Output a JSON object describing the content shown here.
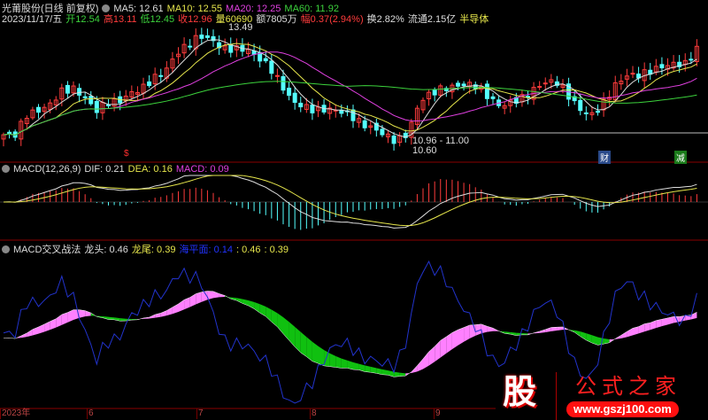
{
  "header": {
    "stock": "光莆股份(日线 前复权)",
    "ma5": "MA5: 12.61",
    "ma10": "MA10: 12.55",
    "ma20": "MA20: 12.25",
    "ma60": "MA60: 11.92",
    "date": "2023/11/17/五",
    "open": "开12.54",
    "high": "高13.11",
    "low": "低12.45",
    "close": "收12.96",
    "volume": "量60690",
    "amount": "额7805万",
    "change": "幅0.37(2.94%)",
    "turnover": "换2.82%",
    "float": "流通2.15亿",
    "sector": "半导体"
  },
  "annotations": {
    "high": "13.49",
    "range": "10.96 - 11.00",
    "low": "10.60",
    "dollar": "$",
    "cai": "财",
    "jian": "减"
  },
  "macd": {
    "title": "MACD(12,26,9)",
    "dif": "DIF: 0.21",
    "dea": "DEA: 0.16",
    "macd": "MACD: 0.09"
  },
  "cross": {
    "title": "MACD交叉战法",
    "head": "龙头: 0.46",
    "tail": "龙尾: 0.39",
    "sea": "海平面: 0.14",
    "v1": ": 0.46",
    "v2": ": 0.39"
  },
  "axis": {
    "labels": [
      "2023年",
      "6",
      "7",
      "8",
      "9"
    ]
  },
  "logo": {
    "char": "股",
    "name": "公式之家",
    "url": "www.gszj100.com"
  },
  "colors": {
    "up": "#ff3c3c",
    "down": "#54ffff",
    "ma5": "#dddddd",
    "ma10": "#e6e64c",
    "ma20": "#e040e0",
    "ma60": "#3cd23c",
    "pink": "#ff80ff",
    "green": "#10c010",
    "sea": "#2233cc"
  },
  "chart_data": {
    "type": "candlestick",
    "price_range": [
      10.6,
      13.49
    ],
    "closes": [
      10.97,
      10.97,
      11.43,
      11.53,
      11.67,
      11.98,
      12.05,
      11.84,
      11.53,
      11.74,
      11.74,
      11.94,
      12.05,
      12.29,
      12.46,
      12.87,
      13.08,
      13.28,
      13.18,
      12.97,
      12.97,
      12.97,
      12.77,
      12.56,
      12.15,
      11.74,
      11.63,
      11.53,
      11.57,
      11.53,
      11.43,
      11.22,
      11.12,
      10.97,
      10.81,
      11.01,
      11.74,
      11.94,
      12.05,
      12.09,
      12.15,
      12.11,
      11.84,
      11.63,
      11.74,
      11.84,
      12.05,
      12.21,
      12.19,
      11.84,
      11.53,
      11.43,
      11.74,
      12.15,
      12.36,
      12.36,
      12.46,
      12.56,
      12.62,
      12.62,
      12.97
    ]
  }
}
